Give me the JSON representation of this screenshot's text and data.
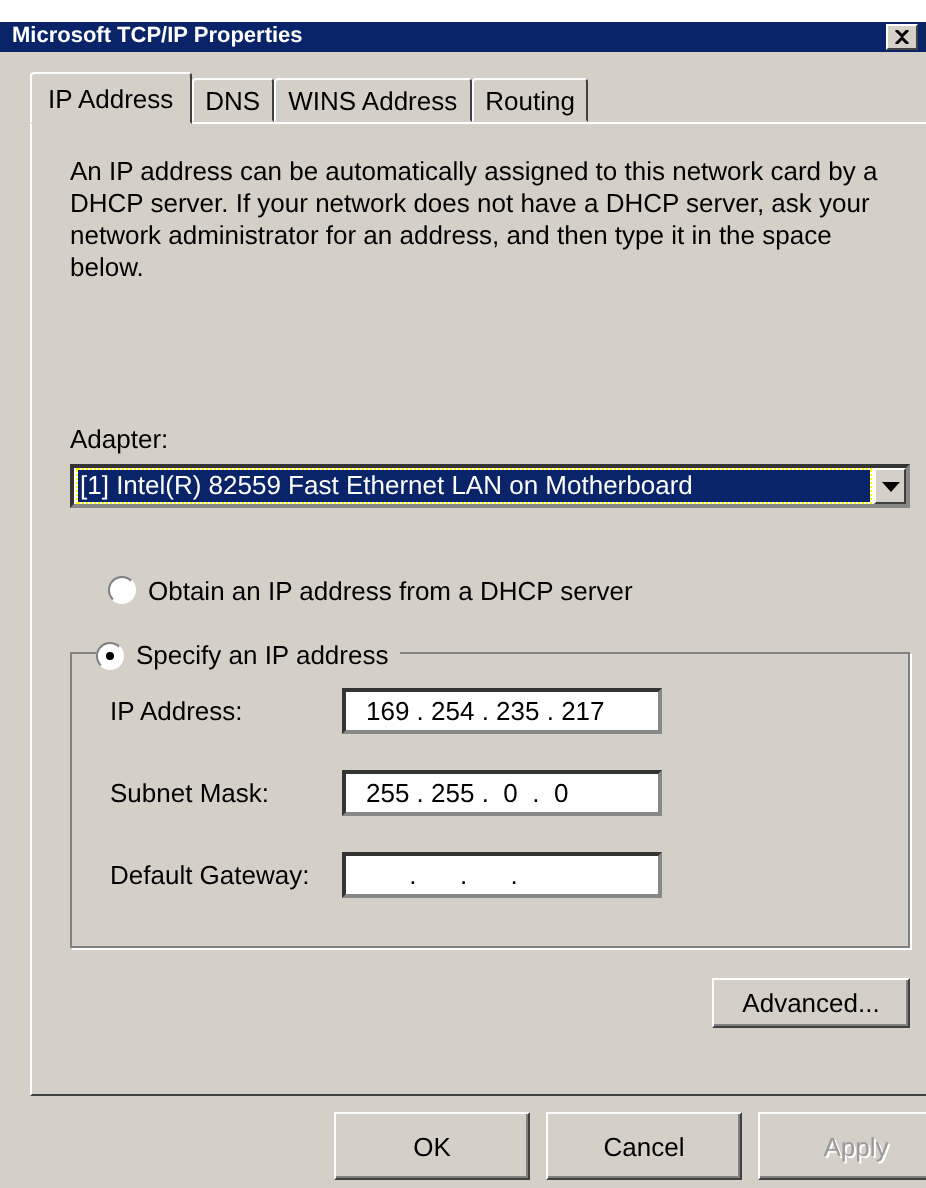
{
  "window": {
    "title": "Microsoft TCP/IP Properties"
  },
  "tabs": [
    {
      "label": "IP Address",
      "selected": true
    },
    {
      "label": "DNS",
      "selected": false
    },
    {
      "label": "WINS Address",
      "selected": false
    },
    {
      "label": "Routing",
      "selected": false
    }
  ],
  "description": "An IP address can be automatically assigned to this network card by a DHCP server.  If your network does not have a DHCP server, ask your network administrator for an address, and then type it in the space below.",
  "adapter": {
    "label": "Adapter:",
    "value": "[1] Intel(R) 82559 Fast Ethernet LAN on Motherboard"
  },
  "options": [
    {
      "label": "Obtain an IP address from a DHCP server",
      "selected": false
    },
    {
      "label": "Specify an IP address",
      "selected": true
    }
  ],
  "fields": [
    {
      "label": "IP Address:",
      "value": "169 . 254 . 235 . 217"
    },
    {
      "label": "Subnet Mask:",
      "value": "255 . 255 .  0  .  0"
    },
    {
      "label": "Default Gateway:",
      "value": "      .      .      ."
    }
  ],
  "advanced_button": {
    "label": "Advanced...",
    "disabled": false
  },
  "buttons": [
    {
      "label": "OK",
      "disabled": false
    },
    {
      "label": "Cancel",
      "disabled": false
    },
    {
      "label": "Apply",
      "disabled": true
    }
  ]
}
